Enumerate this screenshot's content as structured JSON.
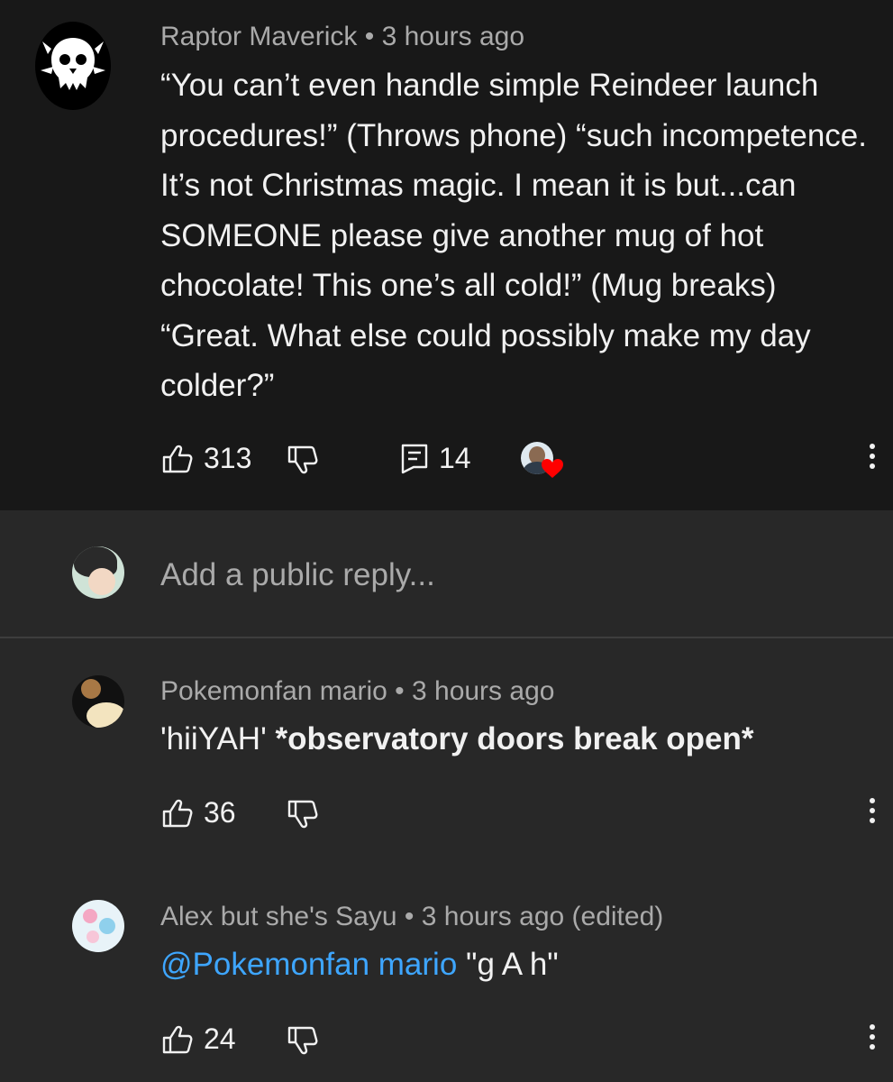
{
  "comments": [
    {
      "author": "Raptor Maverick",
      "time": "3 hours ago",
      "text": "“You can’t even handle simple Reindeer launch procedures!” (Throws phone) “such incompetence. It’s not Christmas magic. I mean it is but...can SOMEONE please give another mug of hot chocolate! This one’s all cold!” (Mug breaks) “Great. What else could possibly make my day colder?”",
      "likes": "313",
      "replies": "14"
    },
    {
      "author": "Pokemonfan mario",
      "time": "3 hours ago",
      "text_plain": "'hiiYAH' ",
      "text_bold": "*observatory doors break open*",
      "likes": "36"
    },
    {
      "author": "Alex but she's Sayu",
      "time": "3 hours ago (edited)",
      "mention": "@Pokemonfan mario",
      "text": " \"g A h\"",
      "likes": "24"
    }
  ],
  "reply_box": {
    "placeholder": "Add a public reply..."
  },
  "separator": " • ",
  "colors": {
    "heart": "#ff0000",
    "mention": "#3ea6ff",
    "background_top": "#181818",
    "background": "#282828"
  },
  "icons": [
    "like-icon",
    "dislike-icon",
    "reply-icon",
    "more-vert-icon",
    "creator-heart-icon"
  ]
}
